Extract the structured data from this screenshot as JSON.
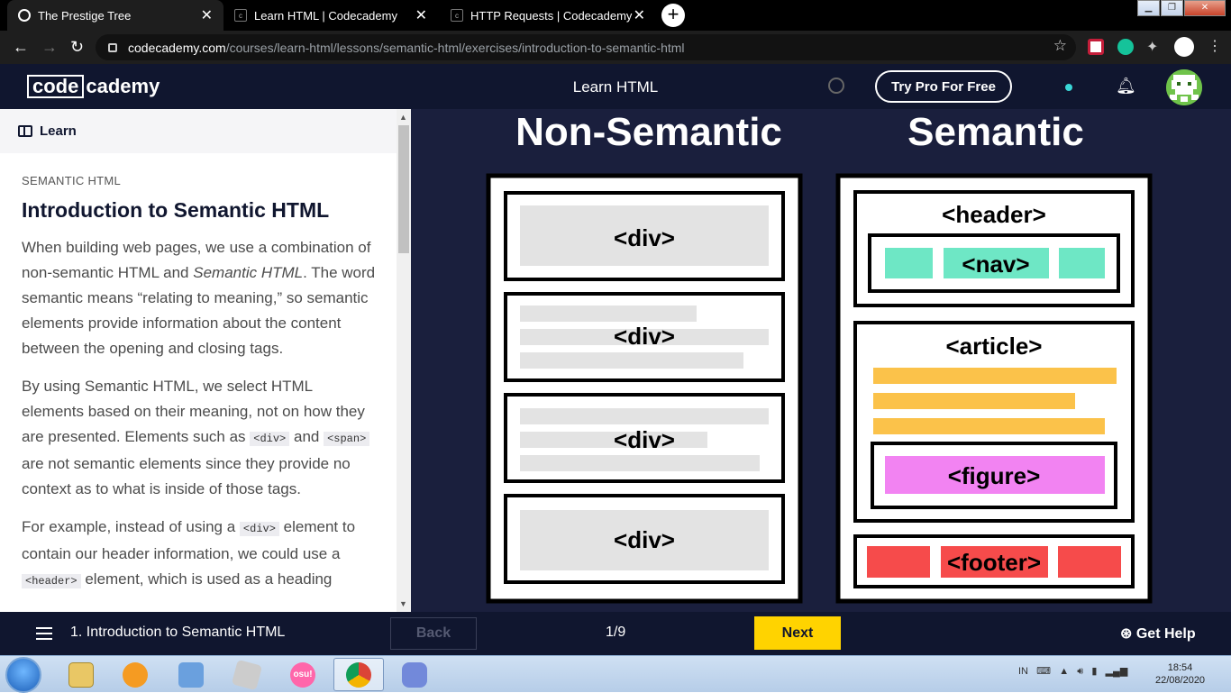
{
  "browser": {
    "tabs": [
      {
        "title": "The Prestige Tree",
        "active": true
      },
      {
        "title": "Learn HTML | Codecademy",
        "active": false
      },
      {
        "title": "HTTP Requests | Codecademy",
        "active": false
      }
    ],
    "url_host": "codecademy.com",
    "url_path": "/courses/learn-html/lessons/semantic-html/exercises/introduction-to-semantic-html"
  },
  "header": {
    "logo_code": "code",
    "logo_rest": "cademy",
    "course_title": "Learn HTML",
    "try_pro": "Try Pro For Free"
  },
  "panel": {
    "learn_label": "Learn",
    "eyebrow": "SEMANTIC HTML",
    "title": "Introduction to Semantic HTML",
    "p1_a": "When building web pages, we use a combination of non-semantic HTML and ",
    "p1_em": "Semantic HTML",
    "p1_b": ". The word semantic means “relating to meaning,” so semantic elements provide information about the content between the opening and closing tags.",
    "p2_a": "By using Semantic HTML, we select HTML elements based on their meaning, not on how they are presented. Elements such as ",
    "p2_code1": "<div>",
    "p2_b": " and ",
    "p2_code2": "<span>",
    "p2_c": " are not semantic elements since they provide no context as to what is inside of those tags.",
    "p3_a": "For example, instead of using a ",
    "p3_code1": "<div>",
    "p3_b": " element to contain our header information, we could use a ",
    "p3_code2": "<header>",
    "p3_c": " element, which is used as a heading"
  },
  "diagram": {
    "left_title": "Non-Semantic",
    "right_title": "Semantic",
    "div_label": "<div>",
    "header_label": "<header>",
    "nav_label": "<nav>",
    "article_label": "<article>",
    "figure_label": "<figure>",
    "footer_label": "<footer>",
    "colors": {
      "bg": "#1a1f3d",
      "nav": "#6ee7c5",
      "article": "#fbc24a",
      "figure": "#f283f2",
      "footer": "#f64b4b",
      "grey": "#e3e3e3"
    }
  },
  "bottom": {
    "lesson": "1. Introduction to Semantic HTML",
    "back": "Back",
    "progress": "1/9",
    "next": "Next",
    "help": "Get Help"
  },
  "taskbar": {
    "lang": "IN",
    "time": "18:54",
    "date": "22/08/2020",
    "osu_label": "osu!"
  }
}
